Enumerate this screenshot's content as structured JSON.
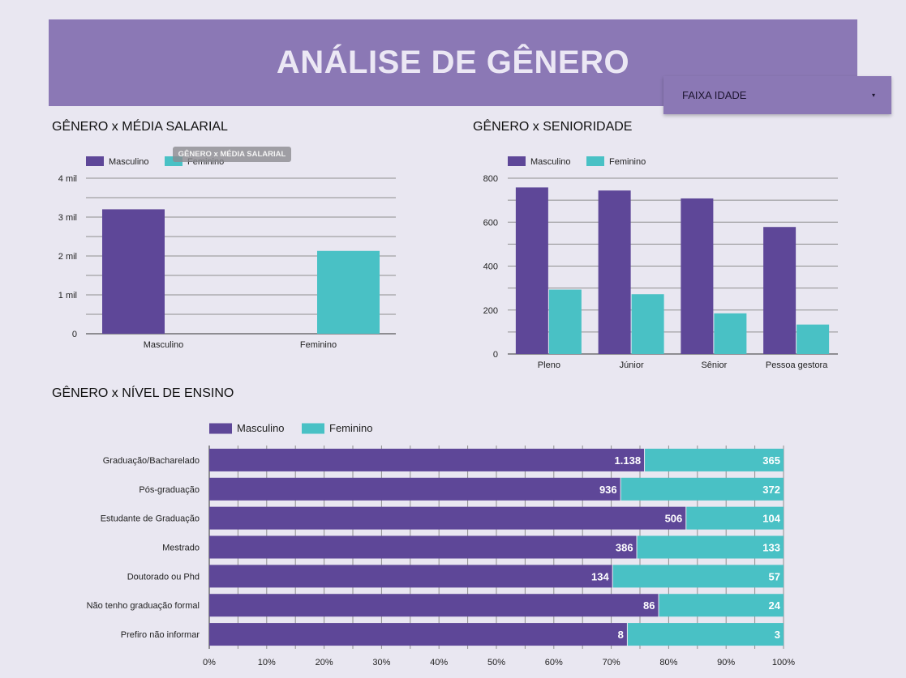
{
  "header": {
    "title": "ANÁLISE DE GÊNERO"
  },
  "filter": {
    "label": "FAIXA IDADE",
    "arrow": "▾"
  },
  "colors": {
    "masculino": "#5e4798",
    "feminino": "#49c1c5",
    "header": "#8b78b5",
    "background": "#e9e7f1"
  },
  "chart_data": [
    {
      "id": "salary",
      "type": "bar",
      "title": "GÊNERO x MÉDIA SALARIAL",
      "tooltip": "GÊNERO x MÉDIA SALARIAL",
      "categories": [
        "Masculino",
        "Feminino"
      ],
      "series": [
        {
          "name": "Masculino",
          "values": [
            3200,
            null
          ]
        },
        {
          "name": "Feminino",
          "values": [
            null,
            2130
          ]
        }
      ],
      "yticks": [
        0,
        1000,
        2000,
        3000,
        4000
      ],
      "ytick_labels": [
        "0",
        "1 mil",
        "2 mil",
        "3 mil",
        "4 mil"
      ],
      "ylim": [
        0,
        4000
      ],
      "legend": "top-left",
      "grid": true
    },
    {
      "id": "seniority",
      "type": "bar",
      "title": "GÊNERO x SENIORIDADE",
      "categories": [
        "Pleno",
        "Júnior",
        "Sênior",
        "Pessoa gestora"
      ],
      "series": [
        {
          "name": "Masculino",
          "values": [
            758,
            744,
            708,
            578
          ]
        },
        {
          "name": "Feminino",
          "values": [
            293,
            272,
            185,
            134
          ]
        }
      ],
      "yticks": [
        0,
        200,
        400,
        600,
        800
      ],
      "ytick_labels": [
        "0",
        "200",
        "400",
        "600",
        "800"
      ],
      "ylim": [
        0,
        800
      ],
      "legend": "top-left",
      "grid": true
    },
    {
      "id": "education",
      "type": "bar",
      "orientation": "horizontal",
      "stacked": "percent",
      "title": "GÊNERO x NÍVEL DE ENSINO",
      "categories": [
        "Graduação/Bacharelado",
        "Pós-graduação",
        "Estudante de Graduação",
        "Mestrado",
        "Doutorado ou Phd",
        "Não tenho graduação formal",
        "Prefiro não informar"
      ],
      "series": [
        {
          "name": "Masculino",
          "values": [
            1138,
            936,
            506,
            386,
            134,
            86,
            8
          ],
          "labels": [
            "1.138",
            "936",
            "506",
            "386",
            "134",
            "86",
            "8"
          ]
        },
        {
          "name": "Feminino",
          "values": [
            365,
            372,
            104,
            133,
            57,
            24,
            3
          ],
          "labels": [
            "365",
            "372",
            "104",
            "133",
            "57",
            "24",
            "3"
          ]
        }
      ],
      "xticks": [
        0,
        0.1,
        0.2,
        0.3,
        0.4,
        0.5,
        0.6,
        0.7,
        0.8,
        0.9,
        1.0
      ],
      "xtick_labels": [
        "0%",
        "10%",
        "20%",
        "30%",
        "40%",
        "50%",
        "60%",
        "70%",
        "80%",
        "90%",
        "100%"
      ],
      "xlim": [
        0,
        1
      ],
      "legend": "top-left",
      "grid": true
    }
  ]
}
